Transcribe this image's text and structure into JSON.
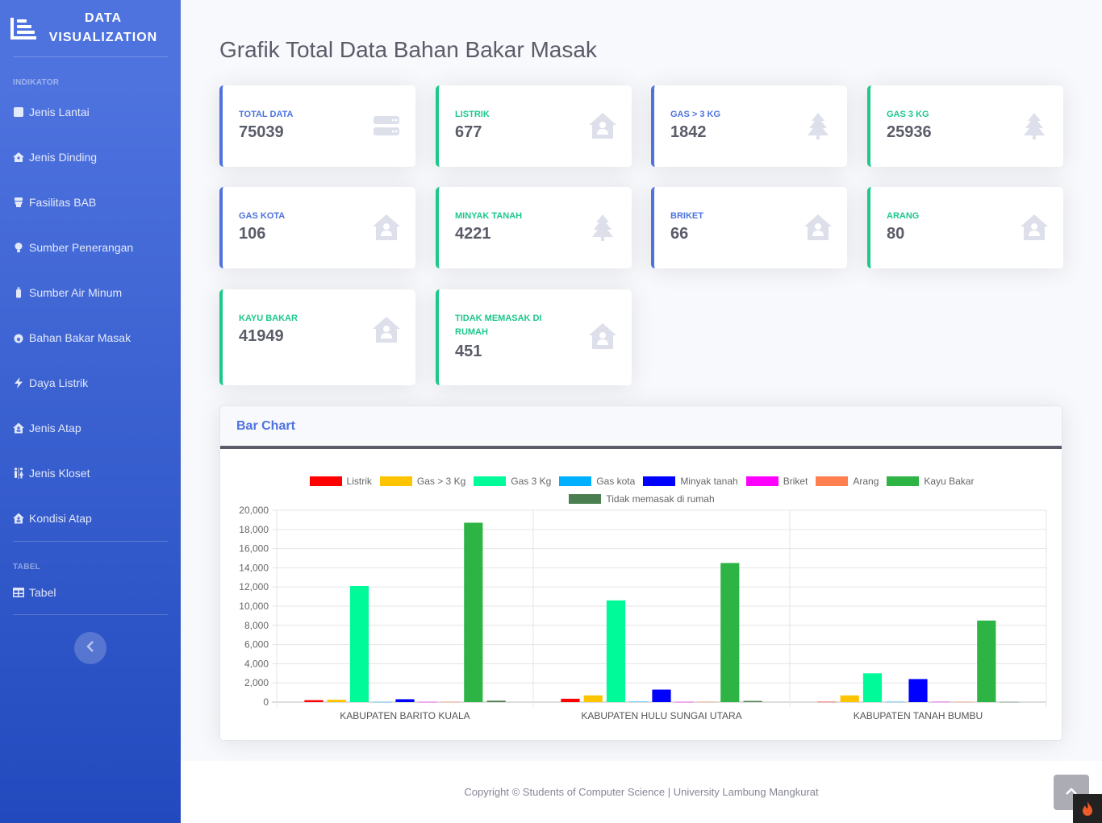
{
  "sidebar": {
    "brand_line1": "DATA",
    "brand_line2": "VISUALIZATION",
    "heading_indikator": "INDIKATOR",
    "items": [
      {
        "label": "Jenis Lantai",
        "icon": "square-icon"
      },
      {
        "label": "Jenis Dinding",
        "icon": "house-icon"
      },
      {
        "label": "Fasilitas BAB",
        "icon": "toilet-icon"
      },
      {
        "label": "Sumber Penerangan",
        "icon": "lightbulb-icon"
      },
      {
        "label": "Sumber Air Minum",
        "icon": "bottle-icon"
      },
      {
        "label": "Bahan Bakar Masak",
        "icon": "fire-icon"
      },
      {
        "label": "Daya Listrik",
        "icon": "bolt-icon"
      },
      {
        "label": "Jenis Atap",
        "icon": "house-user-icon"
      },
      {
        "label": "Jenis Kloset",
        "icon": "restroom-icon"
      },
      {
        "label": "Kondisi Atap",
        "icon": "house-user-icon"
      }
    ],
    "heading_tabel": "TABEL",
    "tabel_item": {
      "label": "Tabel",
      "icon": "table-icon"
    }
  },
  "page": {
    "title": "Grafik Total Data Bahan Bakar Masak"
  },
  "cards": [
    {
      "label": "TOTAL DATA",
      "value": "75039",
      "icon": "server-icon",
      "color": "blue"
    },
    {
      "label": "LISTRIK",
      "value": "677",
      "icon": "house-user-icon",
      "color": "green"
    },
    {
      "label": "GAS > 3 KG",
      "value": "1842",
      "icon": "tree-icon",
      "color": "blue"
    },
    {
      "label": "GAS 3 KG",
      "value": "25936",
      "icon": "tree-icon",
      "color": "green"
    },
    {
      "label": "GAS KOTA",
      "value": "106",
      "icon": "house-user-icon",
      "color": "blue"
    },
    {
      "label": "MINYAK TANAH",
      "value": "4221",
      "icon": "tree-icon",
      "color": "green"
    },
    {
      "label": "BRIKET",
      "value": "66",
      "icon": "house-user-icon",
      "color": "blue"
    },
    {
      "label": "ARANG",
      "value": "80",
      "icon": "house-user-icon",
      "color": "green"
    },
    {
      "label": "KAYU BAKAR",
      "value": "41949",
      "icon": "house-user-icon",
      "color": "green"
    },
    {
      "label": "TIDAK MEMASAK DI RUMAH",
      "value": "451",
      "icon": "house-user-icon",
      "color": "green"
    }
  ],
  "chart_card": {
    "title": "Bar Chart"
  },
  "chart_data": {
    "type": "bar",
    "categories": [
      "KABUPATEN BARITO KUALA",
      "KABUPATEN HULU SUNGAI UTARA",
      "KABUPATEN TANAH BUMBU"
    ],
    "ylim": [
      0,
      20000
    ],
    "yticks": [
      "20,000",
      "18,000",
      "16,000",
      "14,000",
      "12,000",
      "10,000",
      "8,000",
      "6,000",
      "4,000",
      "2,000",
      "0"
    ],
    "series": [
      {
        "name": "Listrik",
        "color": "#ff0000",
        "values": [
          200,
          350,
          30
        ]
      },
      {
        "name": "Gas > 3 Kg",
        "color": "#ffc400",
        "values": [
          250,
          700,
          700
        ]
      },
      {
        "name": "Gas 3 Kg",
        "color": "#00fa9a",
        "values": [
          12100,
          10600,
          3000
        ]
      },
      {
        "name": "Gas kota",
        "color": "#00b0ff",
        "values": [
          20,
          50,
          30
        ]
      },
      {
        "name": "Minyak tanah",
        "color": "#0000ff",
        "values": [
          300,
          1300,
          2400
        ]
      },
      {
        "name": "Briket",
        "color": "#ff00ff",
        "values": [
          20,
          20,
          30
        ]
      },
      {
        "name": "Arang",
        "color": "#ff7f50",
        "values": [
          20,
          30,
          30
        ]
      },
      {
        "name": "Kayu Bakar",
        "color": "#2db445",
        "values": [
          18700,
          14500,
          8500
        ]
      },
      {
        "name": "Tidak memasak di rumah",
        "color": "#4b7f52",
        "values": [
          150,
          120,
          20
        ]
      }
    ],
    "grid": true,
    "legend_position": "top"
  },
  "footer": {
    "copyright": "Copyright © Students of Computer Science | University Lambung Mangkurat"
  }
}
